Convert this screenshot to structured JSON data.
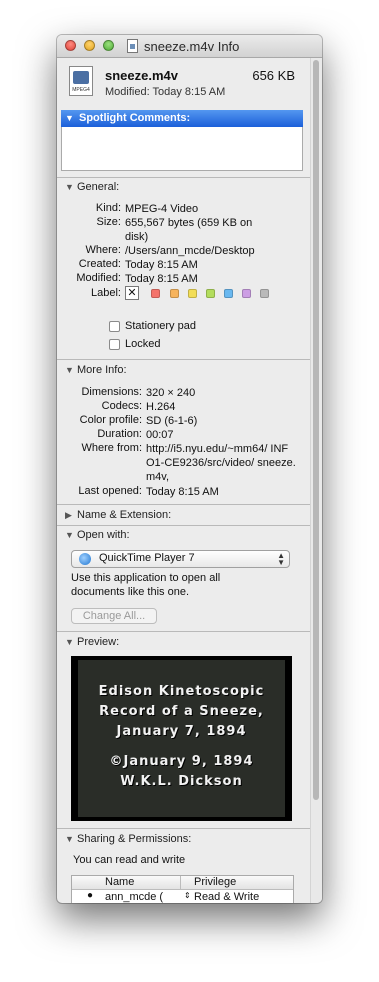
{
  "window": {
    "title": "sneeze.m4v Info"
  },
  "file": {
    "name": "sneeze.m4v",
    "size": "656 KB",
    "modified": "Modified: Today 8:15 AM",
    "icon_label": "MPEG4"
  },
  "spotlight": {
    "label": "Spotlight Comments:"
  },
  "general": {
    "label": "General:",
    "rows": [
      {
        "key": "Kind:",
        "value": "MPEG-4 Video"
      },
      {
        "key": "Size:",
        "value": "655,567 bytes (659 KB on disk)"
      },
      {
        "key": "Where:",
        "value": "/Users/ann_mcde/Desktop"
      },
      {
        "key": "Created:",
        "value": "Today 8:15 AM"
      },
      {
        "key": "Modified:",
        "value": "Today 8:15 AM"
      },
      {
        "key": "Label:",
        "value": ""
      }
    ],
    "label_colors": [
      "#f4736b",
      "#f6b35c",
      "#f2dd57",
      "#b3dd5d",
      "#69b8f0",
      "#cc9ee4",
      "#b9b9b9"
    ],
    "stationery": "Stationery pad",
    "locked": "Locked"
  },
  "more_info": {
    "label": "More Info:",
    "rows": [
      {
        "key": "Dimensions:",
        "value": "320 × 240"
      },
      {
        "key": "Codecs:",
        "value": "H.264"
      },
      {
        "key": "Color profile:",
        "value": "SD (6-1-6)"
      },
      {
        "key": "Duration:",
        "value": "00:07"
      },
      {
        "key": "Where from:",
        "value": "http://i5.nyu.edu/~mm64/ INFO1-CE9236/src/video/ sneeze.m4v,"
      },
      {
        "key": "Last opened:",
        "value": "Today 8:15 AM"
      }
    ]
  },
  "name_extension": {
    "label": "Name & Extension:"
  },
  "open_with": {
    "label": "Open with:",
    "app": "QuickTime Player 7",
    "description": "Use this application to open all documents like this one.",
    "change_all": "Change All..."
  },
  "preview": {
    "label": "Preview:",
    "lines": [
      "Edison Kinetoscopic",
      "Record of a Sneeze,",
      "January 7, 1894",
      "©January 9, 1894",
      "W.K.L. Dickson"
    ]
  },
  "sharing": {
    "label": "Sharing & Permissions:",
    "summary": "You can read and write",
    "columns": [
      "Name",
      "Privilege"
    ],
    "rows": [
      {
        "name": "ann_mcde (",
        "privilege": "Read & Write"
      }
    ]
  }
}
